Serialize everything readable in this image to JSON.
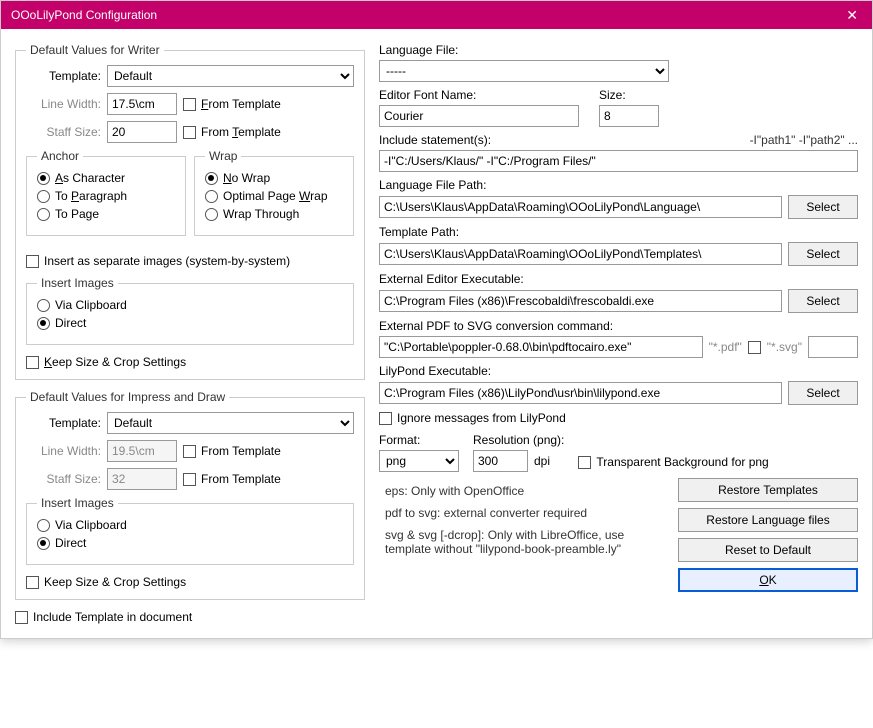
{
  "window": {
    "title": "OOoLilyPond Configuration"
  },
  "writer": {
    "legend": "Default Values for Writer",
    "template_label": "Template:",
    "template_value": "Default",
    "linewidth_label": "Line Width:",
    "linewidth_value": "17.5\\cm",
    "staffsize_label": "Staff Size:",
    "staffsize_value": "20",
    "from_template1": "From Template",
    "from_template2": "From Template",
    "anchor": {
      "legend": "Anchor",
      "as_character": "As Character",
      "to_paragraph": "To Paragraph",
      "to_page": "To Page"
    },
    "wrap": {
      "legend": "Wrap",
      "no_wrap": "No Wrap",
      "optimal": "Optimal Page Wrap",
      "through": "Wrap Through"
    },
    "insert_separate": "Insert as separate images (system-by-system)",
    "insert_images": {
      "legend": "Insert Images",
      "via_clipboard": "Via Clipboard",
      "direct": "Direct"
    },
    "keep_size": "Keep Size & Crop Settings"
  },
  "impress": {
    "legend": "Default Values for Impress and Draw",
    "template_label": "Template:",
    "template_value": "Default",
    "linewidth_label": "Line Width:",
    "linewidth_value": "19.5\\cm",
    "staffsize_label": "Staff Size:",
    "staffsize_value": "32",
    "from_template1": "From Template",
    "from_template2": "From Template",
    "insert_images": {
      "legend": "Insert Images",
      "via_clipboard": "Via Clipboard",
      "direct": "Direct"
    },
    "keep_size": "Keep Size & Crop Settings"
  },
  "include_template": "Include Template in document",
  "right": {
    "lang_file_label": "Language File:",
    "lang_file_value": "-----",
    "font_label": "Editor Font Name:",
    "font_value": "Courier",
    "size_label": "Size:",
    "size_value": "8",
    "include_label": "Include statement(s):",
    "include_hint": "-I\"path1\" -I\"path2\" ...",
    "include_value": "-I\"C:/Users/Klaus/\" -I\"C:/Program Files/\"",
    "lang_path_label": "Language File Path:",
    "lang_path_value": "C:\\Users\\Klaus\\AppData\\Roaming\\OOoLilyPond\\Language\\",
    "tmpl_path_label": "Template Path:",
    "tmpl_path_value": "C:\\Users\\Klaus\\AppData\\Roaming\\OOoLilyPond\\Templates\\",
    "editor_label": "External Editor Executable:",
    "editor_value": "C:\\Program Files (x86)\\Frescobaldi\\frescobaldi.exe",
    "pdf_label": "External PDF to SVG conversion command:",
    "pdf_value": "\"C:\\Portable\\poppler-0.68.0\\bin\\pdftocairo.exe\"",
    "pdf_ext1": "\"*.pdf\"",
    "pdf_ext2": "\"*.svg\"",
    "lily_label": "LilyPond Executable:",
    "lily_value": "C:\\Program Files (x86)\\LilyPond\\usr\\bin\\lilypond.exe",
    "ignore_msgs": "Ignore messages from LilyPond",
    "format_label": "Format:",
    "format_value": "png",
    "res_label": "Resolution (png):",
    "res_value": "300",
    "dpi": "dpi",
    "transparent": "Transparent Background for png",
    "note_eps": "eps: Only with OpenOffice",
    "note_pdf": "pdf to svg: external converter required",
    "note_svg": "svg & svg [-dcrop]: Only with LibreOffice, use template without \"lilypond-book-preamble.ly\"",
    "select": "Select",
    "restore_tmpl": "Restore Templates",
    "restore_lang": "Restore Language files",
    "reset": "Reset to Default",
    "ok": "OK"
  }
}
